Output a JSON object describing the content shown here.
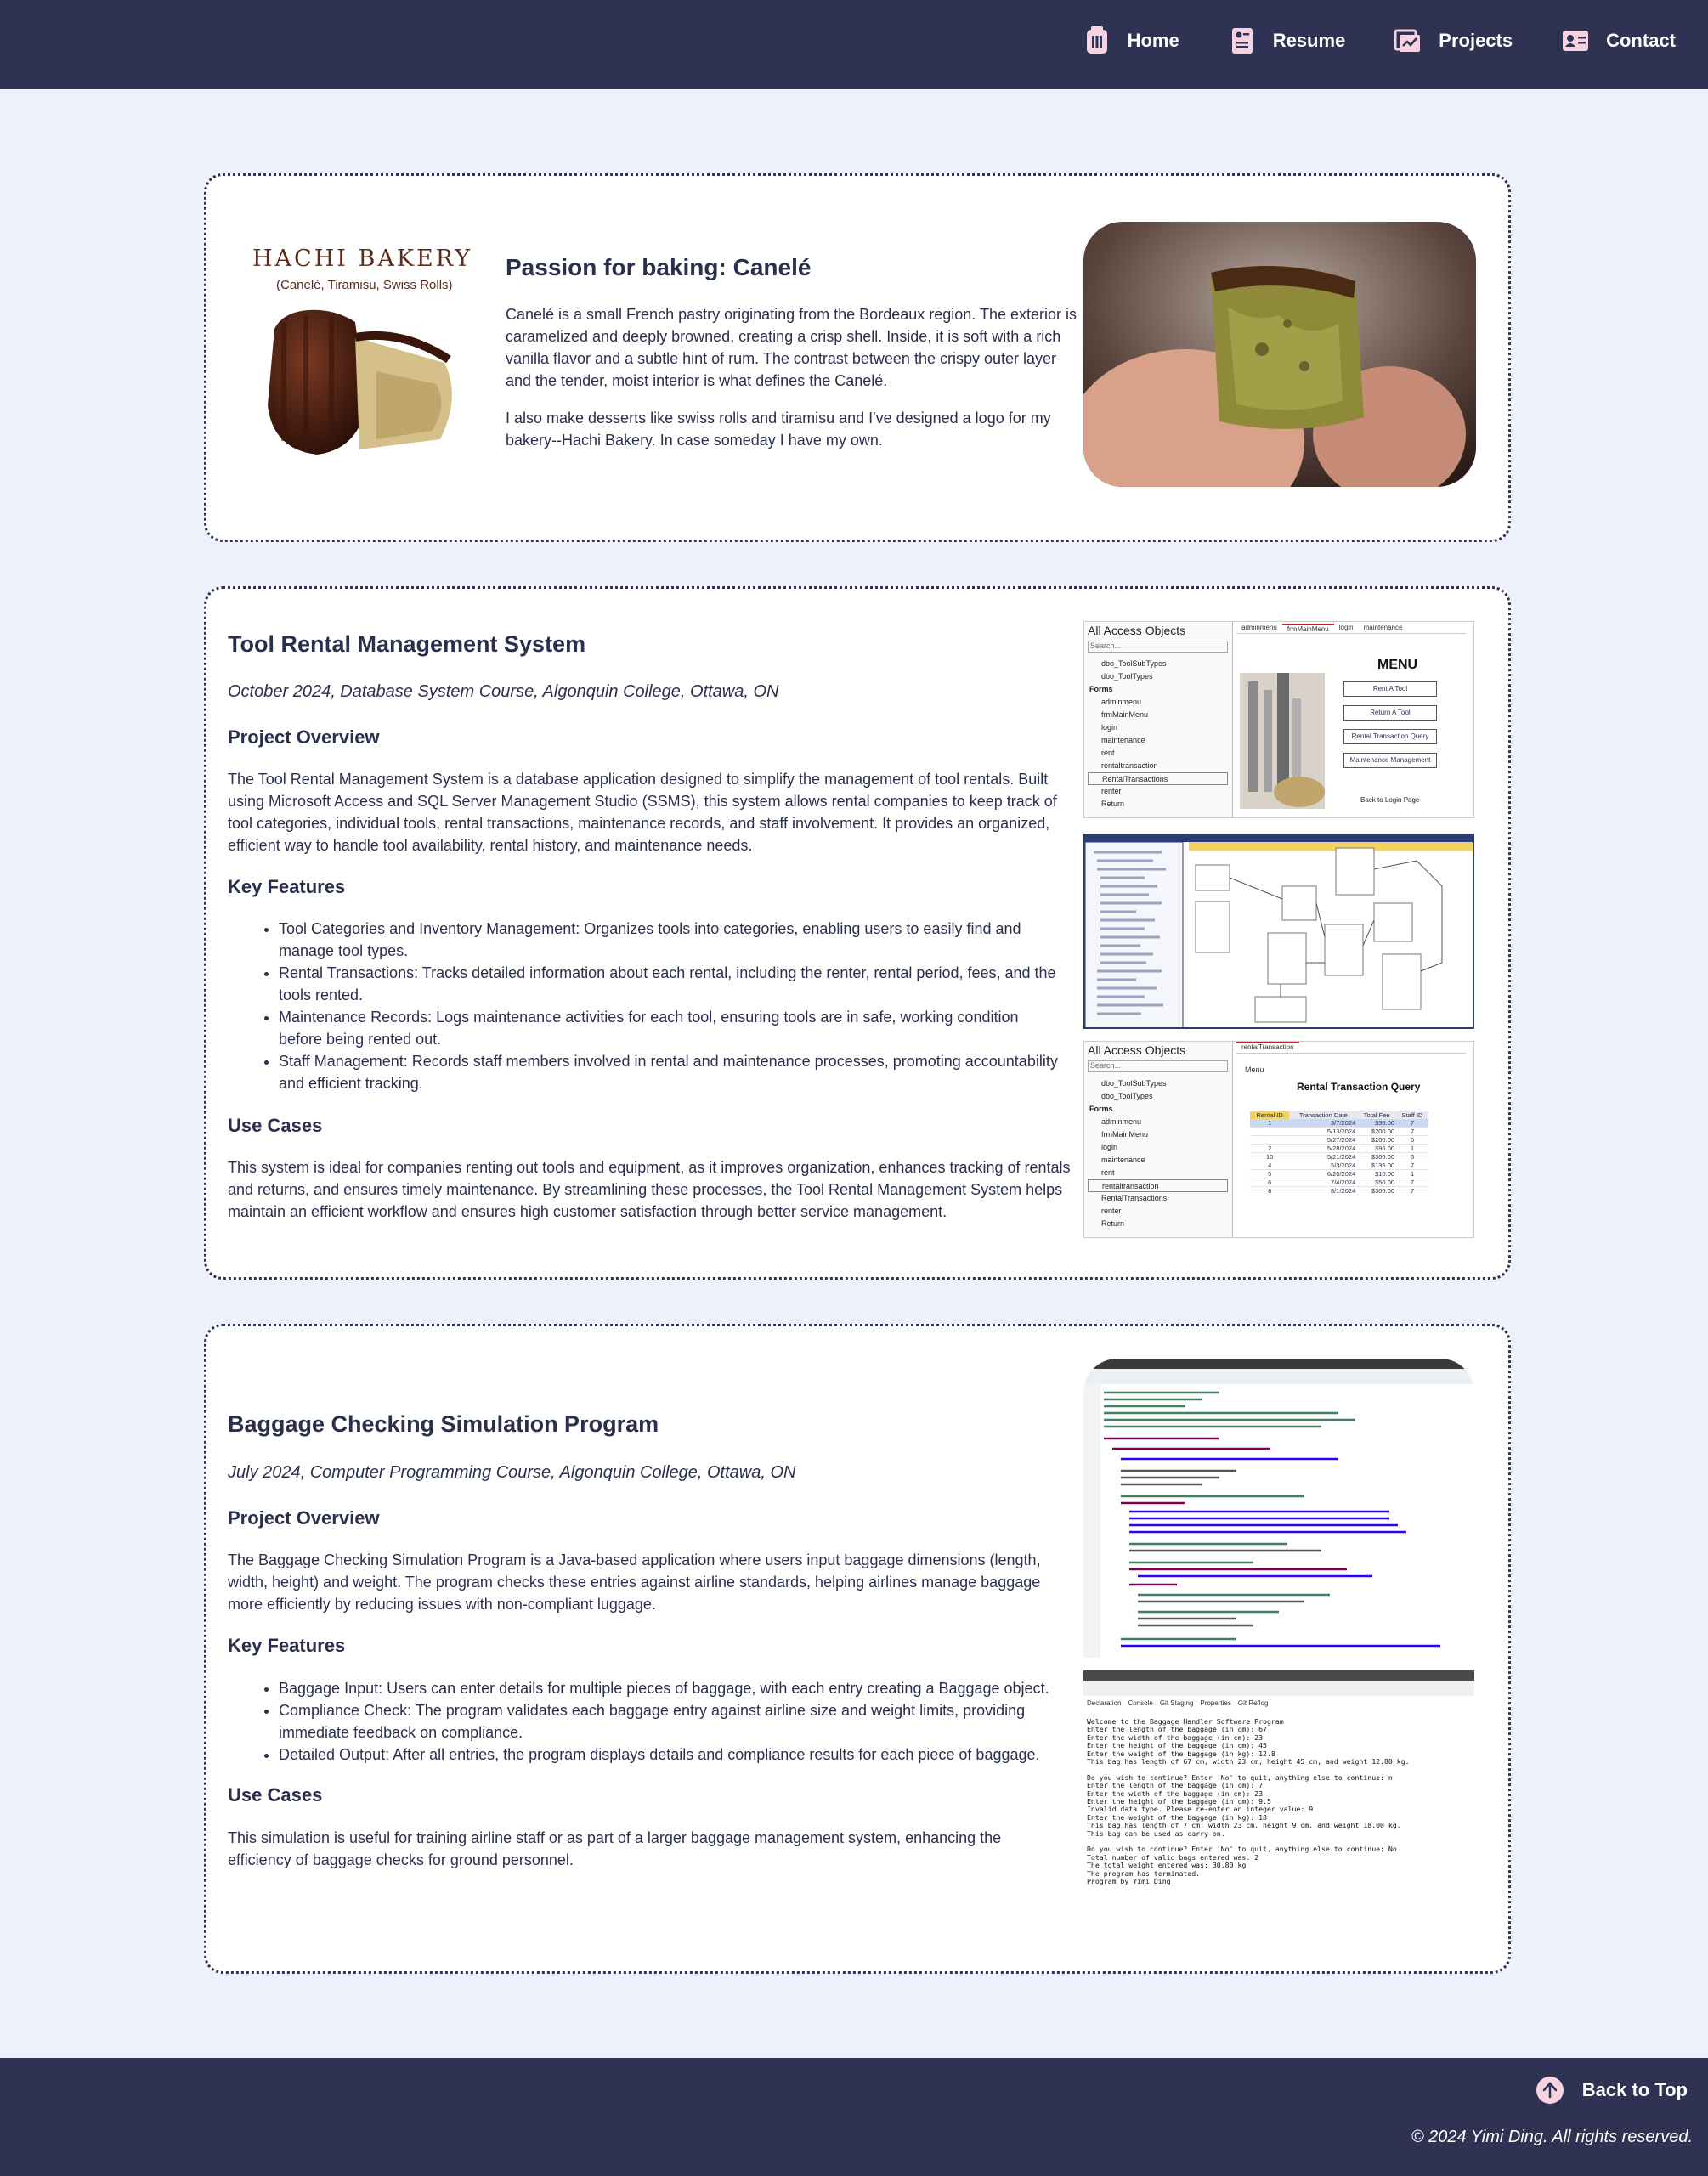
{
  "nav": {
    "items": [
      {
        "label": "Home",
        "icon": "pot-icon"
      },
      {
        "label": "Resume",
        "icon": "resume-icon"
      },
      {
        "label": "Projects",
        "icon": "projects-icon"
      },
      {
        "label": "Contact",
        "icon": "contact-icon"
      }
    ],
    "icon_color": "#f6d3e3",
    "bar_color": "#2f3252"
  },
  "baking": {
    "logo_name": "HACHI BAKERY",
    "logo_sub": "(Canelé, Tiramisu, Swiss Rolls)",
    "title": "Passion for baking: Canelé",
    "para1": "Canelé is a small French pastry originating from the Bordeaux region. The exterior is caramelized and deeply browned, creating a crisp shell. Inside, it is soft with a rich vanilla flavor and a subtle hint of rum. The contrast between the crispy outer layer and the tender, moist interior is what defines the Canelé.",
    "para2": "I also make desserts like swiss rolls and tiramisu and I've designed a logo for my bakery--Hachi Bakery. In case someday I have my own."
  },
  "tool": {
    "title": "Tool Rental Management System",
    "meta": "October 2024, Database System Course, Algonquin College, Ottawa, ON",
    "overview_heading": "Project Overview",
    "overview": "The Tool Rental Management System is a database application designed to simplify the management of tool rentals. Built using Microsoft Access and SQL Server Management Studio (SSMS), this system allows rental companies to keep track of tool categories, individual tools, rental transactions, maintenance records, and staff involvement. It provides an organized, efficient way to handle tool availability, rental history, and maintenance needs.",
    "features_heading": "Key Features",
    "features": [
      "Tool Categories and Inventory Management: Organizes tools into categories, enabling users to easily find and manage tool types.",
      "Rental Transactions: Tracks detailed information about each rental, including the renter, rental period, fees, and the tools rented.",
      "Maintenance Records: Logs maintenance activities for each tool, ensuring tools are in safe, working condition before being rented out.",
      "Staff Management: Records staff members involved in rental and maintenance processes, promoting accountability and efficient tracking."
    ],
    "usecases_heading": "Use Cases",
    "usecases": "This system is ideal for companies renting out tools and equipment, as it improves organization, enhances tracking of rentals and returns, and ensures timely maintenance. By streamlining these processes, the Tool Rental Management System helps maintain an efficient workflow and ensures high customer satisfaction through better service management.",
    "shot1": {
      "panel_title": "All Access Objects",
      "search": "Search...",
      "items": [
        "dbo_ToolSubTypes",
        "dbo_ToolTypes",
        "Forms",
        "adminmenu",
        "frmMainMenu",
        "login",
        "maintenance",
        "rent",
        "rentaltransaction",
        "RentalTransactions",
        "renter",
        "Return"
      ],
      "tabs": [
        "adminmenu",
        "frmMainMenu",
        "login",
        "maintenance"
      ],
      "menu_title": "MENU",
      "buttons": [
        "Rent A Tool",
        "Return A Tool",
        "Rental Transaction Query",
        "Maintenance Management"
      ],
      "back": "Back to Login Page"
    },
    "shot3": {
      "panel_title": "All Access Objects",
      "search": "Search...",
      "items": [
        "dbo_ToolSubTypes",
        "dbo_ToolTypes",
        "Forms",
        "adminmenu",
        "frmMainMenu",
        "login",
        "maintenance",
        "rent",
        "rentaltransaction",
        "RentalTransactions",
        "renter",
        "Return"
      ],
      "tab": "rentalTransaction",
      "menu_link": "Menu",
      "query_title": "Rental Transaction Query",
      "columns": [
        "Rental ID",
        "Transaction Date",
        "Total Fee",
        "Staff ID"
      ],
      "rows": [
        [
          "1",
          "3/7/2024",
          "$36.00",
          "7"
        ],
        [
          "",
          "5/13/2024",
          "$200.00",
          "7"
        ],
        [
          "",
          "5/27/2024",
          "$200.00",
          "6"
        ],
        [
          "2",
          "5/28/2024",
          "$96.00",
          "1"
        ],
        [
          "10",
          "5/21/2024",
          "$300.00",
          "6"
        ],
        [
          "4",
          "5/3/2024",
          "$135.00",
          "7"
        ],
        [
          "5",
          "6/20/2024",
          "$10.00",
          "1"
        ],
        [
          "6",
          "7/4/2024",
          "$50.00",
          "7"
        ],
        [
          "8",
          "8/1/2024",
          "$300.00",
          "7"
        ]
      ]
    }
  },
  "baggage": {
    "title": "Baggage Checking Simulation Program",
    "meta": "July 2024, Computer Programming Course, Algonquin College, Ottawa, ON",
    "overview_heading": "Project Overview",
    "overview": "The Baggage Checking Simulation Program is a Java-based application where users input baggage dimensions (length, width, height) and weight. The program checks these entries against airline standards, helping airlines manage baggage more efficiently by reducing issues with non-compliant luggage.",
    "features_heading": "Key Features",
    "features": [
      "Baggage Input: Users can enter details for multiple pieces of baggage, with each entry creating a Baggage object.",
      "Compliance Check: The program validates each baggage entry against airline size and weight limits, providing immediate feedback on compliance.",
      "Detailed Output: After all entries, the program displays details and compliance results for each piece of baggage."
    ],
    "usecases_heading": "Use Cases",
    "usecases": "This simulation is useful for training airline staff or as part of a larger baggage management system, enhancing the efficiency of baggage checks for ground personnel.",
    "console_tabs": [
      "Declaration",
      "Console",
      "Git Staging",
      "Properties",
      "Git Reflog"
    ],
    "console_lines": [
      "Welcome to the Baggage Handler Software Program",
      "Enter the length of the baggage (in cm): 67",
      "Enter the width of the baggage (in cm): 23",
      "Enter the height of the baggage (in cm): 45",
      "Enter the weight of the baggage (in kg): 12.8",
      "This bag has length of 67 cm, width 23 cm, height 45 cm, and weight 12.80 kg.",
      "",
      "Do you wish to continue? Enter 'No' to quit, anything else to continue: n",
      "Enter the length of the baggage (in cm): 7",
      "Enter the width of the baggage (in cm): 23",
      "Enter the height of the baggage (in cm): 9.5",
      "Invalid data type. Please re-enter an integer value: 9",
      "Enter the weight of the baggage (in kg): 18",
      "This bag has length of 7 cm, width 23 cm, height 9 cm, and weight 18.00 kg.",
      "This bag can be used as carry on.",
      "",
      "Do you wish to continue? Enter 'No' to quit, anything else to continue: No",
      "Total number of valid bags entered was: 2",
      "The total weight entered was: 30.80 kg",
      "The program has terminated.",
      "Program by Yimi Ding"
    ]
  },
  "footer": {
    "back_to_top": "Back to Top",
    "copyright": "© 2024 Yimi Ding. All rights reserved."
  }
}
